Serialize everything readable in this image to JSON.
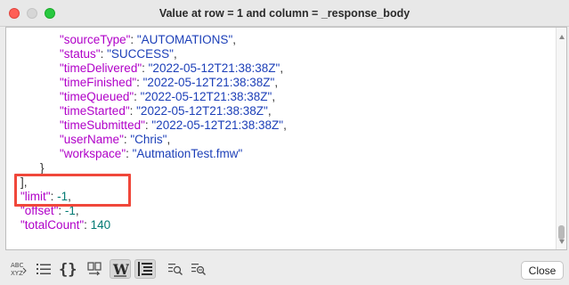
{
  "window": {
    "title": "Value at row = 1 and column = _response_body"
  },
  "editor": {
    "lines": [
      {
        "key": "\"sourceType\"",
        "value": "\"AUTOMATIONS\"",
        "trail": ",",
        "vtype": "s",
        "indent": 2
      },
      {
        "key": "\"status\"",
        "value": "\"SUCCESS\"",
        "trail": ",",
        "vtype": "s",
        "indent": 2
      },
      {
        "key": "\"timeDelivered\"",
        "value": "\"2022-05-12T21:38:38Z\"",
        "trail": ",",
        "vtype": "s",
        "indent": 2
      },
      {
        "key": "\"timeFinished\"",
        "value": "\"2022-05-12T21:38:38Z\"",
        "trail": ",",
        "vtype": "s",
        "indent": 2
      },
      {
        "key": "\"timeQueued\"",
        "value": "\"2022-05-12T21:38:38Z\"",
        "trail": ",",
        "vtype": "s",
        "indent": 2
      },
      {
        "key": "\"timeStarted\"",
        "value": "\"2022-05-12T21:38:38Z\"",
        "trail": ",",
        "vtype": "s",
        "indent": 2
      },
      {
        "key": "\"timeSubmitted\"",
        "value": "\"2022-05-12T21:38:38Z\"",
        "trail": ",",
        "vtype": "s",
        "indent": 2
      },
      {
        "key": "\"userName\"",
        "value": "\"Chris\"",
        "trail": ",",
        "vtype": "s",
        "indent": 2
      },
      {
        "key": "\"workspace\"",
        "value": "\"AutmationTest.fmw\"",
        "trail": "",
        "vtype": "s",
        "indent": 2
      },
      {
        "punct": "}",
        "indent": 1
      },
      {
        "punct": "],",
        "indent": 0
      },
      {
        "key": "\"limit\"",
        "value": "-1",
        "trail": ",",
        "vtype": "n",
        "indent": 0
      },
      {
        "key": "\"offset\"",
        "value": "-1",
        "trail": ",",
        "vtype": "n",
        "indent": 0
      },
      {
        "key": "\"totalCount\"",
        "value": "140",
        "trail": "",
        "vtype": "n",
        "indent": 0
      },
      {
        "punct": "}",
        "indent": -1
      }
    ]
  },
  "toolbar": {
    "icons": [
      "abc-xyz-icon",
      "list-icon",
      "braces-icon",
      "split-view-icon",
      "word-wrap-icon",
      "tree-view-icon",
      "zoom-in-icon",
      "zoom-out-icon"
    ],
    "close_label": "Close"
  },
  "colors": {
    "key": "#b000c8",
    "string": "#1c3fb8",
    "number": "#007a73",
    "highlight": "#f0473a"
  }
}
